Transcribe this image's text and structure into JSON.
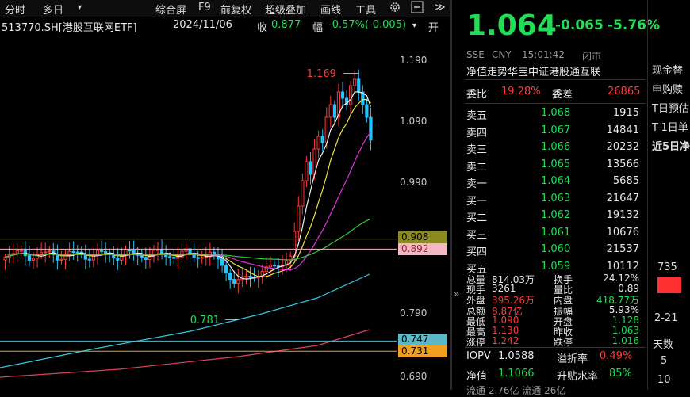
{
  "toolbar": {
    "timeshare": "分时",
    "multiday": "多日",
    "dropdown": "▾",
    "composite": "综合屏",
    "f9": "F9",
    "pre_adjust": "前复权",
    "overlay": "超级叠加",
    "draw": "画线",
    "tools": "工具",
    "expand": "≫"
  },
  "infobar": {
    "symbol": "513770.SH[港股互联网ETF]",
    "date": "2024/11/06",
    "close_label": "收",
    "close_value": "0.877",
    "range_label": "幅",
    "range_value": "-0.57%(-0.005)",
    "open_label": "开"
  },
  "chart": {
    "y_ticks": [
      "1.190",
      "1.090",
      "0.990",
      "0.790",
      "0.690"
    ],
    "high_label": "1.169",
    "low_label": "0.781",
    "tag_908": "0.908",
    "tag_892": "0.892",
    "tag_747": "0.747",
    "tag_731": "0.731",
    "colors": {
      "up": "#ff3b3b",
      "down": "#22c4ff",
      "tag_olive": "#8a8a20",
      "tag_pink": "#f4b8c4",
      "tag_teal": "#5ab8c8",
      "tag_orange": "#f0a020"
    }
  },
  "quote": {
    "price": "1.064",
    "change": "-0.065",
    "change_pct": "-5.76%",
    "exchange": "SSE",
    "currency": "CNY",
    "time": "15:01:42",
    "status": "闭市",
    "nav_title": "净值走势华宝中证港股通互联",
    "weibi_label": "委比",
    "weibi_value": "19.28%",
    "weicha_label": "委差",
    "weicha_value": "26865",
    "asks": [
      {
        "label": "卖五",
        "price": "1.068",
        "vol": "1915"
      },
      {
        "label": "卖四",
        "price": "1.067",
        "vol": "14841"
      },
      {
        "label": "卖三",
        "price": "1.066",
        "vol": "20232"
      },
      {
        "label": "卖二",
        "price": "1.065",
        "vol": "13566"
      },
      {
        "label": "卖一",
        "price": "1.064",
        "vol": "5685"
      }
    ],
    "bids": [
      {
        "label": "买一",
        "price": "1.063",
        "vol": "21647"
      },
      {
        "label": "买二",
        "price": "1.062",
        "vol": "19132"
      },
      {
        "label": "买三",
        "price": "1.061",
        "vol": "10676"
      },
      {
        "label": "买四",
        "price": "1.060",
        "vol": "21537"
      },
      {
        "label": "买五",
        "price": "1.059",
        "vol": "10112"
      }
    ],
    "stats": [
      {
        "l1": "总量",
        "v1": "814.03万",
        "l2": "换手",
        "v2": "24.12%"
      },
      {
        "l1": "现手",
        "v1": "3261",
        "l2": "量比",
        "v2": "0.89"
      },
      {
        "l1": "外盘",
        "v1": "395.26万",
        "l2": "内盘",
        "v2": "418.77万"
      },
      {
        "l1": "总额",
        "v1": "8.87亿",
        "l2": "振幅",
        "v2": "5.93%"
      },
      {
        "l1": "最低",
        "v1": "1.090",
        "l2": "开盘",
        "v2": "1.128"
      },
      {
        "l1": "最高",
        "v1": "1.130",
        "l2": "昨收",
        "v2": "1.063"
      },
      {
        "l1": "涨停",
        "v1": "1.242",
        "l2": "跌停",
        "v2": "1.016"
      }
    ],
    "iopv_label": "IOPV",
    "iopv_value": "1.0588",
    "premium_label": "溢折率",
    "premium_value": "0.49%",
    "nav_label": "净值",
    "nav_value": "1.1066",
    "sub_label": "升贴水率",
    "sub_value": "85%",
    "last_row": "流通 2.76亿   流通 26亿"
  },
  "side": {
    "cash": "现金替",
    "subscribe": "申购赎",
    "t_pre": "T日预估",
    "t1": "T-1日单",
    "recent5": "近5日净",
    "bar_value": "735",
    "date": "2-21",
    "days_label": "天数",
    "d5": "5",
    "d10": "10"
  }
}
